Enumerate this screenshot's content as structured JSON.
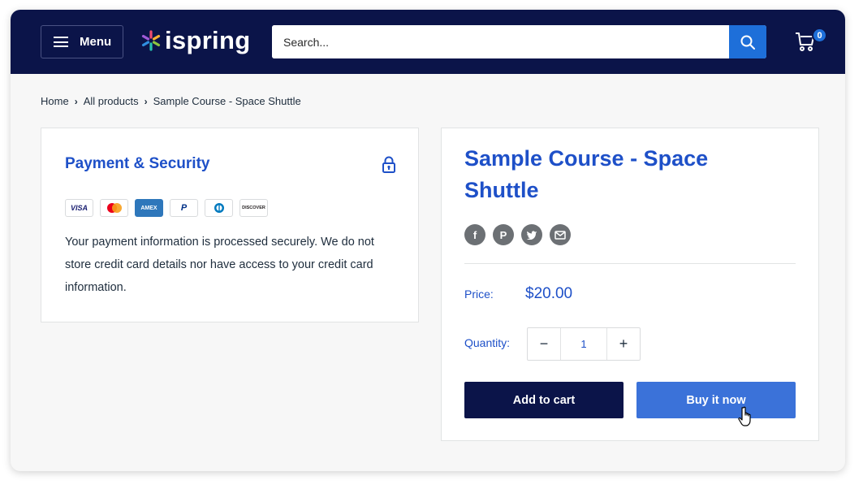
{
  "header": {
    "menu_label": "Menu",
    "logo_text": "ispring",
    "search_placeholder": "Search...",
    "cart_count": "0"
  },
  "breadcrumb": {
    "home": "Home",
    "all_products": "All products",
    "current": "Sample Course - Space Shuttle",
    "separator": "›"
  },
  "payment": {
    "title": "Payment & Security",
    "methods": [
      "VISA",
      "Mastercard",
      "AMEX",
      "PayPal",
      "Diners Club",
      "DISCOVER"
    ],
    "description": "Your payment information is processed securely. We do not store credit card details nor have access to your credit card information."
  },
  "product": {
    "title": "Sample Course - Space Shuttle",
    "share": [
      "facebook-icon",
      "pinterest-icon",
      "twitter-icon",
      "email-icon"
    ],
    "price_label": "Price:",
    "price": "$20.00",
    "quantity_label": "Quantity:",
    "quantity": "1",
    "minus": "−",
    "plus": "+",
    "add_to_cart": "Add to cart",
    "buy_now": "Buy it now"
  },
  "colors": {
    "header_bg": "#0b1449",
    "accent": "#1e50c8",
    "search_button": "#1e6fd9",
    "buy_button": "#3b72d9"
  }
}
